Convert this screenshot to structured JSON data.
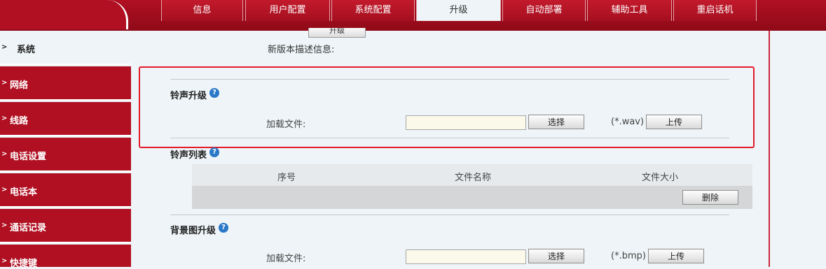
{
  "tabs": [
    {
      "label": "信息"
    },
    {
      "label": "用户配置"
    },
    {
      "label": "系统配置"
    },
    {
      "label": "升级"
    },
    {
      "label": "自动部署"
    },
    {
      "label": "辅助工具"
    },
    {
      "label": "重启话机"
    }
  ],
  "sidebar": {
    "items": [
      {
        "label": "系统"
      },
      {
        "label": "网络"
      },
      {
        "label": "线路"
      },
      {
        "label": "电话设置"
      },
      {
        "label": "电话本"
      },
      {
        "label": "通话记录"
      },
      {
        "label": "快捷键"
      }
    ]
  },
  "firmware": {
    "upgrade_label": "升级",
    "desc_label": "新版本描述信息:"
  },
  "ringtone_upgrade": {
    "title": "铃声升级",
    "load_label": "加载文件:",
    "select_label": "选择",
    "ext": "(*.wav)",
    "upload_label": "上传"
  },
  "ringtone_list": {
    "title": "铃声列表",
    "columns": [
      "序号",
      "文件名称",
      "文件大小"
    ],
    "delete_label": "删除"
  },
  "background_upgrade": {
    "title": "背景图升级",
    "load_label": "加载文件:",
    "select_label": "选择",
    "ext": "(*.bmp)",
    "upload_label": "上传"
  },
  "help_glyph": "?",
  "colors": {
    "brand": "#b01022",
    "highlight": "#e31b2b",
    "help": "#2a78c8"
  }
}
